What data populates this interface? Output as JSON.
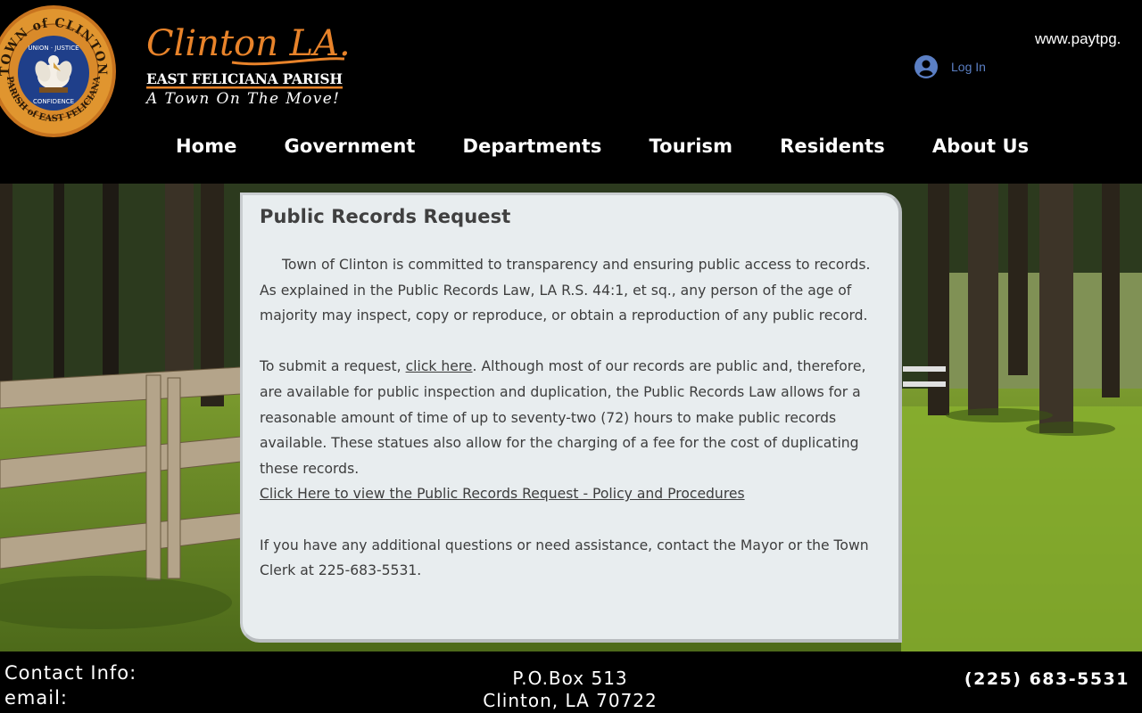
{
  "header": {
    "seal": {
      "icon": "town-seal-icon",
      "text_top": "TOWN of CLINTON",
      "text_bottom": "PARISH of EAST FELICIANA",
      "motto_top": "UNION · JUSTICE",
      "motto_bottom": "CONFIDENCE"
    },
    "logo": {
      "script_title": "Clinton LA.",
      "parish": "EAST FELICIANA PARISH",
      "tagline": "A Town On The Move!"
    },
    "paytpg_text": "www.paytpg.",
    "login_label": "Log In",
    "nav": [
      {
        "label": "Home"
      },
      {
        "label": "Government"
      },
      {
        "label": "Departments"
      },
      {
        "label": "Tourism"
      },
      {
        "label": "Residents"
      },
      {
        "label": "About Us"
      }
    ]
  },
  "card": {
    "title": "Public Records Request",
    "para1": "Town of Clinton is committed to transparency and ensuring public access to records. As explained in the Public Records Law, LA R.S. 44:1, et sq., any person of the age of majority may inspect, copy or reproduce, or obtain a reproduction of any public record.",
    "para2_prefix": "To submit a request, ",
    "para2_link": "click here",
    "para2_suffix": ". Although most of our records are public and, therefore, are available for public inspection and duplication, the Public Records Law allows for a reasonable amount of time of up to seventy-two (72) hours to make public records available. These statues also allow for the charging of a fee for the cost of duplicating these records.",
    "policy_link": "Click Here to view the Public Records Request - Policy and Procedures",
    "para3": "If you have any additional questions or need assistance, contact the Mayor or the Town Clerk at 225-683-5531."
  },
  "footer": {
    "contact_label": "Contact Info:",
    "email_label": "email:",
    "address_line1": "P.O.Box 513",
    "address_line2": "Clinton, LA 70722",
    "phone": "(225) 683-5531"
  },
  "colors": {
    "accent_orange": "#e8832a",
    "login_blue": "#5b7fc4",
    "card_bg": "#e8edef"
  }
}
